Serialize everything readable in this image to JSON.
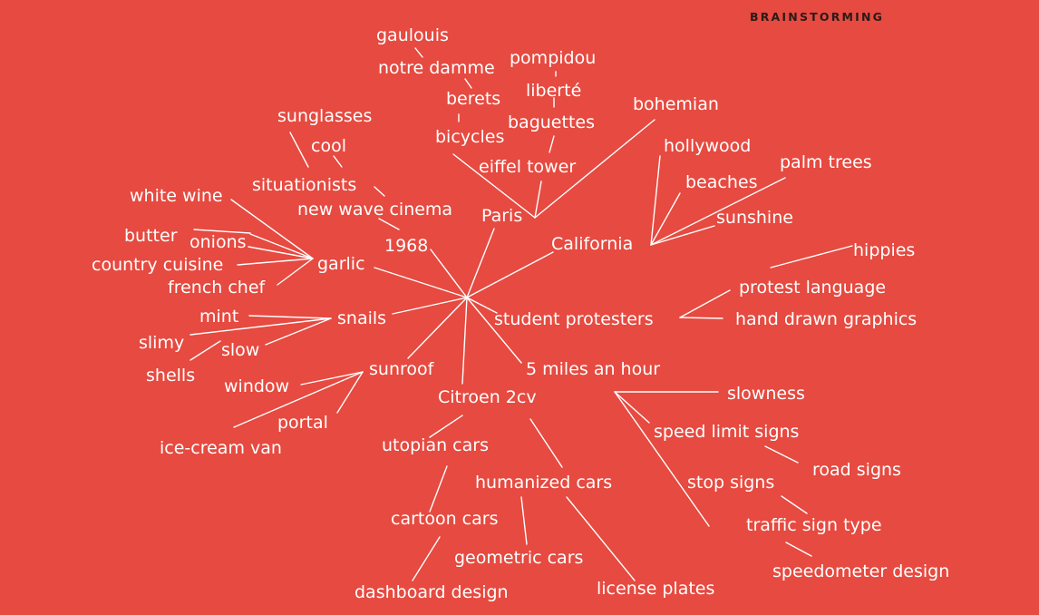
{
  "header": {
    "title": "BRAINSTORMING"
  },
  "colors": {
    "background": "#E64A40",
    "ink": "#FFFFFF",
    "header_ink": "#2A1A18"
  },
  "mindmap": {
    "hub": "",
    "groups": [
      {
        "node": "Paris",
        "children": [
          "bicycles",
          "eiffel tower",
          "bohemian",
          "baguettes",
          "liberté",
          "pompidou",
          "berets",
          "notre damme",
          "gaulouis"
        ]
      },
      {
        "node": "California",
        "children": [
          "hollywood",
          "beaches",
          "palm trees",
          "sunshine"
        ]
      },
      {
        "node": "1968",
        "children": [
          "new wave cinema",
          "situationists",
          "cool",
          "sunglasses"
        ]
      },
      {
        "node": "garlic",
        "children": [
          "white wine",
          "butter",
          "onions",
          "country cuisine",
          "french chef"
        ]
      },
      {
        "node": "snails",
        "children": [
          "mint",
          "slimy",
          "slow",
          "shells"
        ]
      },
      {
        "node": "sunroof",
        "children": [
          "window",
          "portal",
          "ice-cream van"
        ]
      },
      {
        "node": "Citroen 2cv",
        "children": [
          "utopian cars",
          "humanized cars",
          "cartoon cars",
          "dashboard design",
          "geometric cars",
          "license plates"
        ]
      },
      {
        "node": "student protesters",
        "children": [
          "protest language",
          "hand drawn graphics",
          "hippies"
        ]
      },
      {
        "node": "5 miles an hour",
        "children": [
          "slowness",
          "speed limit signs",
          "road signs",
          "stop signs",
          "traffic sign type",
          "speedometer design"
        ]
      }
    ]
  }
}
